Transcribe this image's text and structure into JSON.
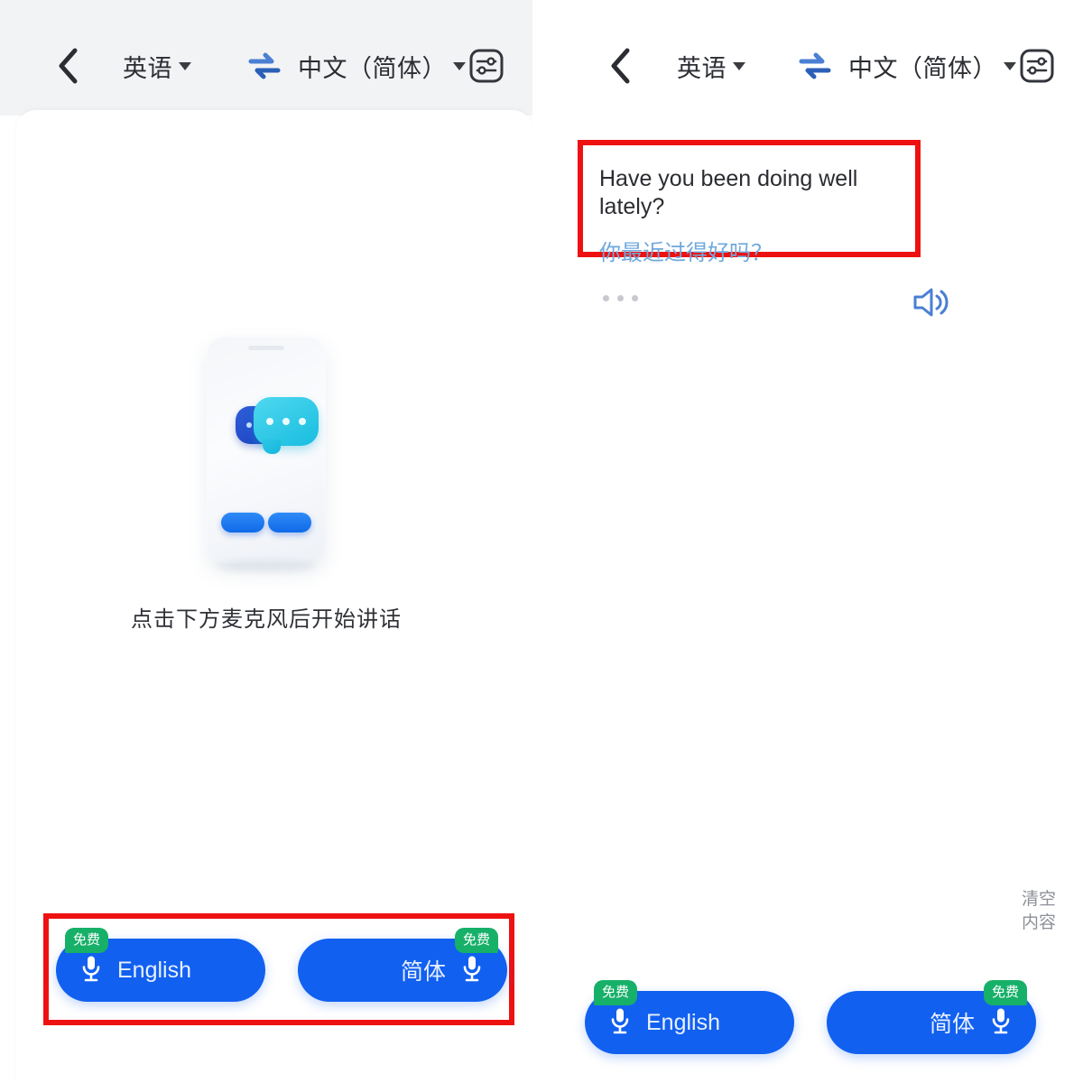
{
  "app": {
    "source_language": "英语",
    "target_language": "中文（简体）",
    "swap_icon": "swap-horizontal-icon",
    "settings_icon": "sliders-settings-icon",
    "back_icon": "back-chevron-icon",
    "caret_icon": "caret-down-icon",
    "accent_blue": "#1160f0",
    "badge_green": "#17b069",
    "highlight_red": "#ee1111",
    "translated_text_color": "#6fa8dc"
  },
  "left_panel": {
    "empty_state": {
      "illustration": "phone-with-chat-bubbles-illustration",
      "caption": "点击下方麦克风后开始讲话"
    },
    "mic_bar": {
      "source_button": {
        "label": "English",
        "badge": "免费",
        "icon": "microphone-icon"
      },
      "target_button": {
        "label": "简体",
        "badge": "免费",
        "icon": "microphone-icon"
      }
    }
  },
  "right_panel": {
    "translation_card": {
      "source_text": "Have you been doing well lately?",
      "target_text": "你最近过得好吗？",
      "more_icon": "more-dots-icon",
      "speaker_icon": "speaker-volume-icon"
    },
    "clear_label": "清空\n内容",
    "clear_label_line1": "清空",
    "clear_label_line2": "内容",
    "mic_bar": {
      "source_button": {
        "label": "English",
        "badge": "免费",
        "icon": "microphone-icon"
      },
      "target_button": {
        "label": "简体",
        "badge": "免费",
        "icon": "microphone-icon"
      }
    }
  }
}
